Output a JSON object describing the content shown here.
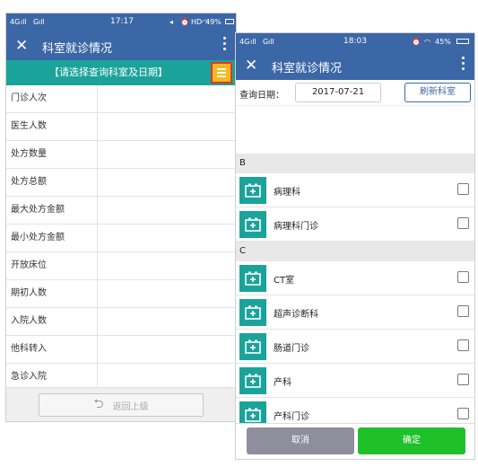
{
  "left": {
    "status": {
      "network": "4G",
      "signal2": "G",
      "time": "17:17",
      "icons": "HD",
      "battery": "49%"
    },
    "title": "科室就诊情况",
    "banner": "【请选择查询科室及日期】",
    "rows": [
      {
        "label": "门诊人次"
      },
      {
        "label": "医生人数"
      },
      {
        "label": "处方数量"
      },
      {
        "label": "处方总额"
      },
      {
        "label": "最大处方金额"
      },
      {
        "label": "最小处方金额"
      },
      {
        "label": "开放床位"
      },
      {
        "label": "期初人数"
      },
      {
        "label": "入院人数"
      },
      {
        "label": "他科转入"
      },
      {
        "label": "急诊入院"
      }
    ],
    "back_label": "返回上级"
  },
  "right": {
    "status": {
      "network": "4G",
      "signal2": "G",
      "time": "18:03",
      "battery": "45%"
    },
    "title": "科室就诊情况",
    "query_label": "查询日期：",
    "query_date": "2017-07-21",
    "refresh_label": "刷新科室",
    "groups": [
      {
        "letter": "B",
        "depts": [
          "病理科",
          "病理科门诊"
        ]
      },
      {
        "letter": "C",
        "depts": [
          "CT室",
          "超声诊断科",
          "肠道门诊",
          "产科",
          "产科门诊"
        ]
      }
    ],
    "cancel_label": "取消",
    "ok_label": "确定"
  },
  "colors": {
    "header": "#3c67a6",
    "teal": "#1aa39a",
    "menu": "#f5b91f",
    "highlight": "#d63b2b",
    "ok": "#1fc12a",
    "cancel": "#8e8e9c"
  }
}
